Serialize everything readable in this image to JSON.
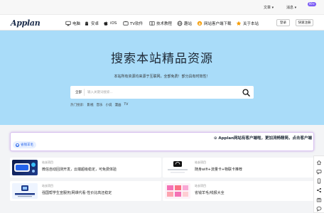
{
  "topbar": {
    "lang": "文章 ▾",
    "msg": "消息 ▾",
    "badge": "99+"
  },
  "nav": {
    "logo": "Applan",
    "items": [
      {
        "label": "电脑",
        "icon": "monitor-icon"
      },
      {
        "label": "安卓",
        "icon": "android-icon"
      },
      {
        "label": "iOS",
        "icon": "apple-icon"
      },
      {
        "label": "TV软件",
        "icon": "tv-icon"
      },
      {
        "label": "技术教程",
        "icon": "book-icon"
      },
      {
        "label": "趣站",
        "icon": "globe-icon"
      },
      {
        "label": "网站客户端下载",
        "icon": "download-icon"
      },
      {
        "label": "关于本站",
        "icon": "star-icon"
      }
    ],
    "login": "登录",
    "register": "快速注册"
  },
  "hero": {
    "title": "搜索本站精品资源",
    "subtitle": "本站所有资源均来源于互联网，全部免费！部分具有时效性！",
    "search_all": "全部",
    "search_placeholder": "输入关键词搜索...",
    "hot_label": "热门搜索:",
    "hot_terms": [
      "影视",
      "音乐",
      "小说",
      "漫画",
      "TV"
    ]
  },
  "announce": {
    "text": "⊙ Applan网站有客户端啦，更加流畅精简，点击客户端",
    "pill": "省钱羊毛"
  },
  "cards": [
    {
      "cat": "站长项目",
      "title": "微信自动回测开发，云端超级稳定，可免费体验"
    },
    {
      "cat": "站长项目",
      "title": "随身wifi+流量卡+物联卡推荐"
    },
    {
      "cat": "站长项目",
      "title": "强国帮学生宣服务|网课代看·性价比高还稳定"
    },
    {
      "cat": "站长项目",
      "title": "省钱羊毛/线报大全"
    }
  ],
  "colors": {
    "hero": "#a9dcf9",
    "accent": "#2563eb",
    "badge": "#7c5cf5",
    "logo": "#1a2b4a"
  }
}
